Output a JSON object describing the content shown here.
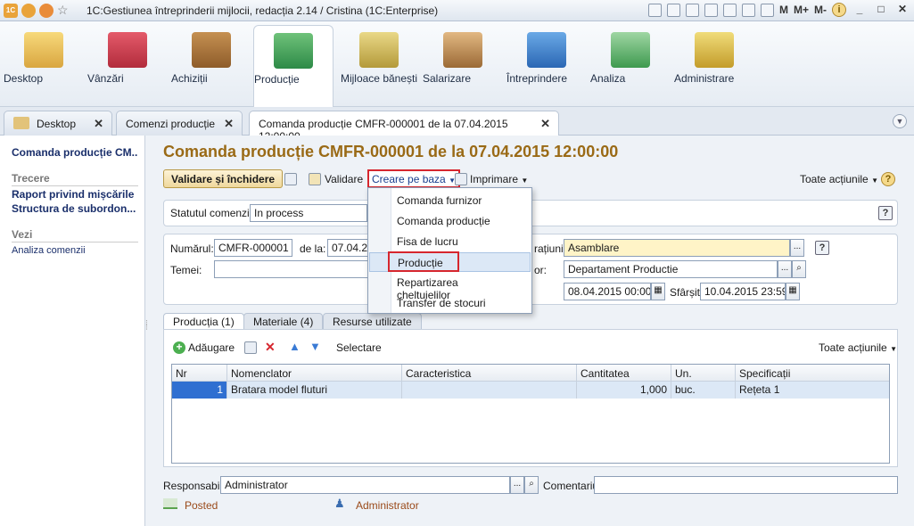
{
  "window": {
    "title": "1C:Gestiunea întreprinderii mijlocii, redacția 2.14 / Cristina  (1C:Enterprise)",
    "logo": "1C",
    "toolbar_right": [
      "M",
      "M+",
      "M-"
    ]
  },
  "sections": [
    {
      "label": "Desktop",
      "icon": "desktop-icon"
    },
    {
      "label": "Vânzări",
      "icon": "sales-icon"
    },
    {
      "label": "Achiziții",
      "icon": "purchases-icon"
    },
    {
      "label": "Producție",
      "icon": "production-icon"
    },
    {
      "label": "Mijloace bănești",
      "icon": "money-icon"
    },
    {
      "label": "Salarizare",
      "icon": "payroll-icon"
    },
    {
      "label": "Întreprindere",
      "icon": "enterprise-icon"
    },
    {
      "label": "Analiza",
      "icon": "analysis-icon"
    },
    {
      "label": "Administrare",
      "icon": "admin-icon"
    }
  ],
  "tabs": [
    {
      "label": "Desktop"
    },
    {
      "label": "Comenzi producție"
    },
    {
      "label": "Comanda producție CMFR-000001 de la 07.04.2015 12:00:00"
    }
  ],
  "left": {
    "current": "Comanda producție CM...",
    "group1": "Trecere",
    "links": [
      "Raport privind mișcările",
      "Structura de subordon..."
    ],
    "group2": "Vezi",
    "links2": [
      "Analiza comenzii"
    ]
  },
  "doc": {
    "title": "Comanda producție CMFR-000001 de la 07.04.2015 12:00:00",
    "btn_validare_inchidere": "Validare și închidere",
    "btn_validare": "Validare",
    "btn_creare": "Creare pe baza",
    "btn_imprimare": "Imprimare",
    "toate_actiunile": "Toate acțiunile",
    "status_label": "Statutul comenzii:",
    "status_value": "In process",
    "numarul_label": "Numărul:",
    "numarul_value": "CMFR-000001",
    "dela_label": "de la:",
    "dela_value": "07.04.20",
    "temei_label": "Temei:",
    "operatiuni_label": "rațiunii:",
    "operatiuni_value": "Asamblare",
    "subdiv_label": "or:",
    "subdiv_value": "Departament Productie",
    "start_value": "08.04.2015 00:00:0",
    "sfarsit_label": "Sfârșit:",
    "sfarsit_value": "10.04.2015 23:59:5",
    "responsabil_label": "Responsabil:",
    "responsabil_value": "Administrator",
    "comentariu_label": "Comentariu:",
    "status_posted": "Posted",
    "author": "Administrator"
  },
  "dropdown": [
    "Comanda furnizor",
    "Comanda producție",
    "Fisa de lucru",
    "Producție",
    "Repartizarea cheltuielilor",
    "Transfer de stocuri"
  ],
  "inner_tabs": [
    "Producția (1)",
    "Materiale (4)",
    "Resurse utilizate"
  ],
  "table_toolbar": {
    "add": "Adăugare",
    "select": "Selectare",
    "actions": "Toate acțiunile"
  },
  "table": {
    "headers": [
      "Nr",
      "Nomenclator",
      "Caracteristica",
      "Cantitatea",
      "Un.",
      "Specificații"
    ],
    "rows": [
      [
        "1",
        "Bratara model fluturi",
        "",
        "1,000",
        "buc.",
        "Rețeta 1"
      ]
    ]
  }
}
